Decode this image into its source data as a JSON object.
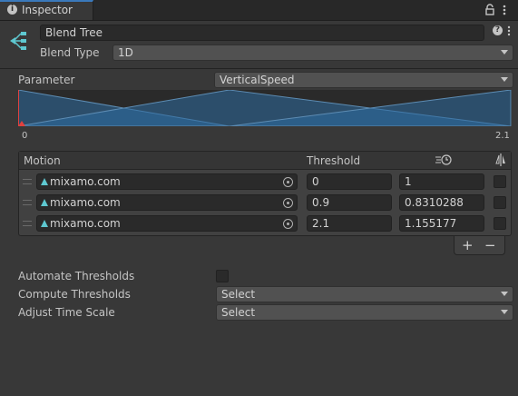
{
  "tab": {
    "title": "Inspector",
    "info_icon": "info-icon",
    "lock_icon": "lock-icon",
    "menu_icon": "kebab-menu-icon"
  },
  "header": {
    "name_value": "Blend Tree",
    "help_glyph": "?",
    "blend_type_label": "Blend Type",
    "blend_type_value": "1D"
  },
  "parameter": {
    "label": "Parameter",
    "value": "VerticalSpeed",
    "range_min": "0",
    "range_max": "2.1",
    "thresholds": [
      0,
      0.9,
      2.1
    ],
    "colors": {
      "fill": "#2d6ca1",
      "line": "#5d8cb3",
      "marker": "#e0413f"
    }
  },
  "table": {
    "col_motion": "Motion",
    "col_threshold": "Threshold",
    "col_speed_icon": "time-scale-icon",
    "col_mirror_icon": "mirror-icon",
    "rows": [
      {
        "motion": "mixamo.com",
        "threshold": "0",
        "time_scale": "1"
      },
      {
        "motion": "mixamo.com",
        "threshold": "0.9",
        "time_scale": "0.8310288"
      },
      {
        "motion": "mixamo.com",
        "threshold": "2.1",
        "time_scale": "1.155177"
      }
    ],
    "add_glyph": "+",
    "remove_glyph": "−"
  },
  "settings": {
    "automate_label": "Automate Thresholds",
    "compute_label": "Compute Thresholds",
    "compute_value": "Select",
    "adjust_label": "Adjust Time Scale",
    "adjust_value": "Select"
  }
}
